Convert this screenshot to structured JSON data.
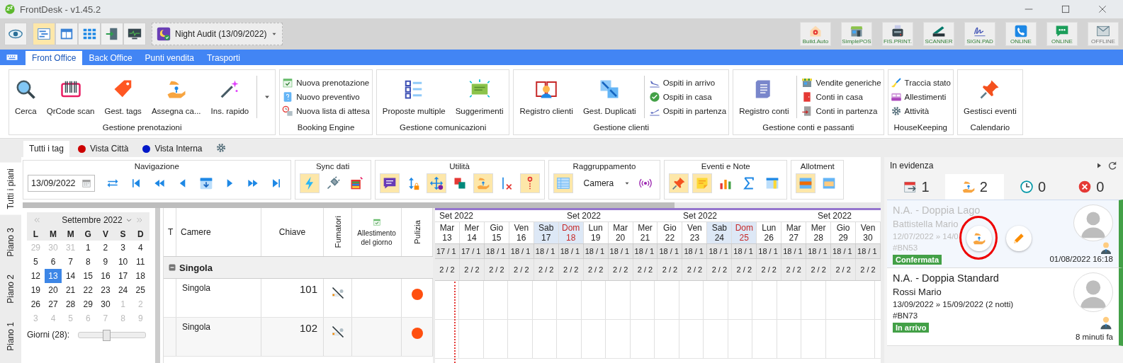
{
  "window": {
    "title": "FrontDesk - v1.45.2"
  },
  "toolbar": {
    "view_buttons": [
      {
        "selected": false
      },
      {
        "selected": true
      },
      {
        "selected": false
      },
      {
        "selected": false
      },
      {
        "selected": false
      },
      {
        "selected": false
      }
    ],
    "night_audit": "Night Audit (13/09/2022)",
    "devices": [
      {
        "label": "Build.Auto",
        "online": true
      },
      {
        "label": "SimplePOS",
        "online": true
      },
      {
        "label": "FIS.PRINT.",
        "online": true
      },
      {
        "label": "SCANNER",
        "online": true
      },
      {
        "label": "SIGN.PAD",
        "online": true
      },
      {
        "label": "ONLINE",
        "online": true
      },
      {
        "label": "ONLINE",
        "online": true
      },
      {
        "label": "OFFLINE",
        "online": false
      }
    ]
  },
  "menu_tabs": [
    {
      "label": "Front Office",
      "selected": true
    },
    {
      "label": "Back Office",
      "selected": false
    },
    {
      "label": "Punti vendita",
      "selected": false
    },
    {
      "label": "Trasporti",
      "selected": false
    }
  ],
  "ribbon": [
    {
      "title": "Gestione prenotazioni",
      "large": [
        "Cerca",
        "QrCode scan",
        "Gest. tags",
        "Assegna ca...",
        "Ins. rapido"
      ],
      "more": true
    },
    {
      "title": "Booking Engine",
      "small": [
        "Nuova prenotazione",
        "Nuovo preventivo",
        "Nuova lista di attesa"
      ]
    },
    {
      "title": "Gestione comunicazioni",
      "large": [
        "Proposte multiple",
        "Suggerimenti"
      ]
    },
    {
      "title": "Gestione clienti",
      "large": [
        "Registro clienti",
        "Gest. Duplicati"
      ],
      "small": [
        "Ospiti in arrivo",
        "Ospiti in casa",
        "Ospiti in partenza"
      ]
    },
    {
      "title": "Gestione conti e passanti",
      "large": [
        "Registro conti"
      ],
      "small": [
        "Vendite generiche",
        "Conti in casa",
        "Conti in partenza"
      ]
    },
    {
      "title": "HouseKeeping",
      "small": [
        "Traccia stato",
        "Allestimenti",
        "Attività"
      ]
    },
    {
      "title": "Calendario",
      "large": [
        "Gestisci eventi"
      ]
    }
  ],
  "view_tabs": [
    {
      "label": "Tutti i tag",
      "selected": true
    },
    {
      "label": "Vista Città",
      "selected": false,
      "color": "#cc0000"
    },
    {
      "label": "Vista Interna",
      "selected": false,
      "color": "#0018c8"
    }
  ],
  "floor_tabs": [
    {
      "label": "Tutti i piani",
      "selected": true
    },
    {
      "label": "Piano 3",
      "selected": false
    },
    {
      "label": "Piano 2",
      "selected": false
    },
    {
      "label": "Piano 1",
      "selected": false
    }
  ],
  "tool_groups": [
    {
      "title": "Navigazione",
      "date": "13/09/2022",
      "buttons": [
        {
          "selected": false
        },
        {
          "selected": false
        },
        {
          "selected": false
        },
        {
          "selected": false
        },
        {
          "selected": false
        },
        {
          "selected": false
        },
        {
          "selected": false
        },
        {
          "selected": false
        }
      ]
    },
    {
      "title": "Sync dati",
      "buttons": [
        {
          "selected": true
        },
        {
          "selected": false
        },
        {
          "selected": false
        }
      ]
    },
    {
      "title": "Utilità",
      "buttons": [
        {
          "selected": true
        },
        {
          "selected": false
        },
        {
          "selected": true
        },
        {
          "selected": false
        },
        {
          "selected": true
        },
        {
          "selected": false
        },
        {
          "selected": true
        }
      ]
    },
    {
      "title": "Raggruppamento",
      "select": "Camera",
      "buttons": [
        {
          "selected": true
        },
        {
          "selected": false
        }
      ]
    },
    {
      "title": "Eventi e Note",
      "buttons": [
        {
          "selected": true
        },
        {
          "selected": true
        },
        {
          "selected": false
        },
        {
          "selected": false
        },
        {
          "selected": false
        }
      ]
    },
    {
      "title": "Allotment",
      "buttons": [
        {
          "selected": true
        },
        {
          "selected": false
        }
      ]
    }
  ],
  "calendar": {
    "month": "Settembre 2022",
    "weekdays": [
      "L",
      "M",
      "M",
      "G",
      "V",
      "S",
      "D"
    ],
    "weeks": [
      [
        {
          "day": "29",
          "outside": true,
          "selected": false
        },
        {
          "day": "30",
          "outside": true,
          "selected": false
        },
        {
          "day": "31",
          "outside": true,
          "selected": false
        },
        {
          "day": "1",
          "outside": false,
          "selected": false
        },
        {
          "day": "2",
          "outside": false,
          "selected": false
        },
        {
          "day": "3",
          "outside": false,
          "selected": false
        },
        {
          "day": "4",
          "outside": false,
          "selected": false
        }
      ],
      [
        {
          "day": "5",
          "outside": false,
          "selected": false
        },
        {
          "day": "6",
          "outside": false,
          "selected": false
        },
        {
          "day": "7",
          "outside": false,
          "selected": false
        },
        {
          "day": "8",
          "outside": false,
          "selected": false
        },
        {
          "day": "9",
          "outside": false,
          "selected": false
        },
        {
          "day": "10",
          "outside": false,
          "selected": false
        },
        {
          "day": "11",
          "outside": false,
          "selected": false
        }
      ],
      [
        {
          "day": "12",
          "outside": false,
          "selected": false
        },
        {
          "day": "13",
          "outside": false,
          "selected": true
        },
        {
          "day": "14",
          "outside": false,
          "selected": false
        },
        {
          "day": "15",
          "outside": false,
          "selected": false
        },
        {
          "day": "16",
          "outside": false,
          "selected": false
        },
        {
          "day": "17",
          "outside": false,
          "selected": false
        },
        {
          "day": "18",
          "outside": false,
          "selected": false
        }
      ],
      [
        {
          "day": "19",
          "outside": false,
          "selected": false
        },
        {
          "day": "20",
          "outside": false,
          "selected": false
        },
        {
          "day": "21",
          "outside": false,
          "selected": false
        },
        {
          "day": "22",
          "outside": false,
          "selected": false
        },
        {
          "day": "23",
          "outside": false,
          "selected": false
        },
        {
          "day": "24",
          "outside": false,
          "selected": false
        },
        {
          "day": "25",
          "outside": false,
          "selected": false
        }
      ],
      [
        {
          "day": "26",
          "outside": false,
          "selected": false
        },
        {
          "day": "27",
          "outside": false,
          "selected": false
        },
        {
          "day": "28",
          "outside": false,
          "selected": false
        },
        {
          "day": "29",
          "outside": false,
          "selected": false
        },
        {
          "day": "30",
          "outside": false,
          "selected": false
        },
        {
          "day": "1",
          "outside": true,
          "selected": false
        },
        {
          "day": "2",
          "outside": true,
          "selected": false
        }
      ],
      [
        {
          "day": "3",
          "outside": true,
          "selected": false
        },
        {
          "day": "4",
          "outside": true,
          "selected": false
        },
        {
          "day": "5",
          "outside": true,
          "selected": false
        },
        {
          "day": "6",
          "outside": true,
          "selected": false
        },
        {
          "day": "7",
          "outside": true,
          "selected": false
        },
        {
          "day": "8",
          "outside": true,
          "selected": false
        },
        {
          "day": "9",
          "outside": true,
          "selected": false
        }
      ]
    ],
    "days_label": "Giorni (28):",
    "days_slider": {
      "level": 0.4
    }
  },
  "table": {
    "columns": [
      "T",
      "Camere",
      "Chiave",
      "Fumatori",
      "Allestimento del giorno",
      "Pulizia"
    ],
    "group": {
      "label": "Singola",
      "expanded": true
    },
    "rows": [
      {
        "room": "Singola",
        "key": "101",
        "smoking": false,
        "color": "#ff4f0f"
      },
      {
        "room": "Singola",
        "key": "102",
        "smoking": false,
        "color": "#ff4f0f"
      }
    ]
  },
  "timeline": {
    "months": [
      "Set 2022",
      "Set 2022",
      "Set 2022",
      "Set 2022"
    ],
    "days": [
      {
        "dow": "Mar",
        "day": "13",
        "weekend": false,
        "holiday": false,
        "avail": "17 / 1",
        "count": "2 / 2"
      },
      {
        "dow": "Mer",
        "day": "14",
        "weekend": false,
        "holiday": false,
        "avail": "17 / 1",
        "count": "2 / 2"
      },
      {
        "dow": "Gio",
        "day": "15",
        "weekend": false,
        "holiday": false,
        "avail": "18 / 1",
        "count": "2 / 2"
      },
      {
        "dow": "Ven",
        "day": "16",
        "weekend": false,
        "holiday": false,
        "avail": "18 / 1",
        "count": "2 / 2"
      },
      {
        "dow": "Sab",
        "day": "17",
        "weekend": true,
        "holiday": false,
        "avail": "18 / 1",
        "count": "2 / 2"
      },
      {
        "dow": "Dom",
        "day": "18",
        "weekend": true,
        "holiday": true,
        "avail": "18 / 1",
        "count": "2 / 2"
      },
      {
        "dow": "Lun",
        "day": "19",
        "weekend": false,
        "holiday": false,
        "avail": "18 / 1",
        "count": "2 / 2"
      },
      {
        "dow": "Mar",
        "day": "20",
        "weekend": false,
        "holiday": false,
        "avail": "18 / 1",
        "count": "2 / 2"
      },
      {
        "dow": "Mer",
        "day": "21",
        "weekend": false,
        "holiday": false,
        "avail": "18 / 1",
        "count": "2 / 2"
      },
      {
        "dow": "Gio",
        "day": "22",
        "weekend": false,
        "holiday": false,
        "avail": "18 / 1",
        "count": "2 / 2"
      },
      {
        "dow": "Ven",
        "day": "23",
        "weekend": false,
        "holiday": false,
        "avail": "18 / 1",
        "count": "2 / 2"
      },
      {
        "dow": "Sab",
        "day": "24",
        "weekend": true,
        "holiday": false,
        "avail": "18 / 1",
        "count": "2 / 2"
      },
      {
        "dow": "Dom",
        "day": "25",
        "weekend": true,
        "holiday": true,
        "avail": "18 / 1",
        "count": "2 / 2"
      },
      {
        "dow": "Lun",
        "day": "26",
        "weekend": false,
        "holiday": false,
        "avail": "18 / 1",
        "count": "2 / 2"
      },
      {
        "dow": "Mar",
        "day": "27",
        "weekend": false,
        "holiday": false,
        "avail": "18 / 1",
        "count": "2 / 2"
      },
      {
        "dow": "Mer",
        "day": "28",
        "weekend": false,
        "holiday": false,
        "avail": "18 / 1",
        "count": "2 / 2"
      },
      {
        "dow": "Gio",
        "day": "29",
        "weekend": false,
        "holiday": false,
        "avail": "18 / 1",
        "count": "2 / 2"
      },
      {
        "dow": "Ven",
        "day": "30",
        "weekend": false,
        "holiday": false,
        "avail": "18 / 1",
        "count": "2 / 2"
      }
    ]
  },
  "highlights": {
    "title": "In evidenza",
    "counters": [
      {
        "count": "1",
        "selected": false
      },
      {
        "count": "2",
        "selected": true
      },
      {
        "count": "0",
        "selected": false
      },
      {
        "count": "0",
        "selected": false
      }
    ],
    "cards": [
      {
        "title": "N.A. - Doppia Lago",
        "guest": "Battistella Mario",
        "dates": "12/07/2022 » 14/0",
        "code": "#BN53",
        "status": "Confermata",
        "time": "01/08/2022 16:18",
        "hovered": true
      },
      {
        "title": "N.A. - Doppia Standard",
        "guest": "Rossi Mario",
        "dates": "13/09/2022 » 15/09/2022 (2 notti)",
        "code": "#BN73",
        "status": "In arrivo",
        "time": "8 minuti fa",
        "hovered": false
      }
    ]
  }
}
